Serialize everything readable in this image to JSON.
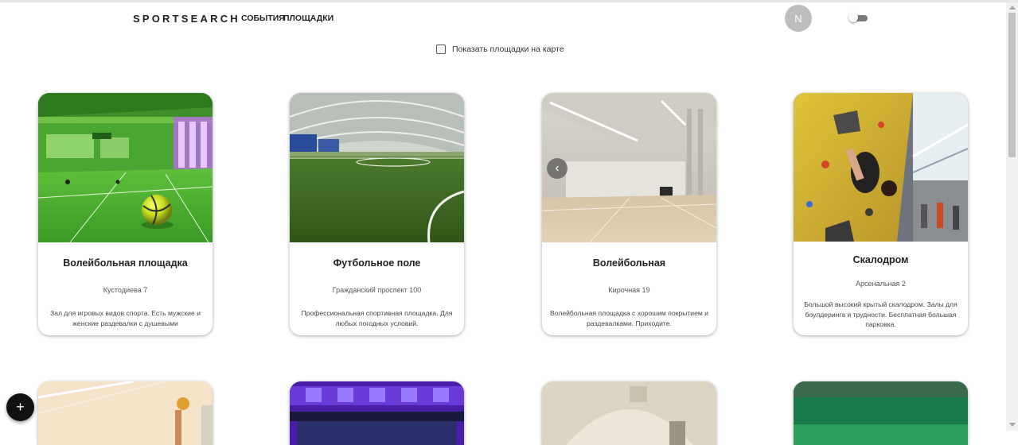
{
  "header": {
    "logo": "SPORTSEARCH",
    "nav": {
      "events": "СОБЫТИЯ",
      "places": "ПЛОЩАДКИ"
    },
    "avatar_initial": "N"
  },
  "map_toggle": {
    "label": "Показать площадки на карте",
    "checked": false
  },
  "cards": [
    {
      "title": "Волейбольная площадка",
      "address": "Кустодиева 7",
      "description": "Зал для игровых видов спорта. Есть мужские и женские раздевалки с душевыми"
    },
    {
      "title": "Футбольное поле",
      "address": "Гражданский проспект 100",
      "description": "Профессиональная спортивная площадка. Для любых погодных условий."
    },
    {
      "title": "Волейбольная",
      "address": "Кирочная 19",
      "description": "Волейбольная площадка с хорошим покрытием и раздевалками. Приходите."
    },
    {
      "title": "Скалодром",
      "address": "Арсенальная 2",
      "description": "Большой высокий крытый скалодром. Залы для боулдеринга и трудности. Бесплатная большая парковка."
    }
  ],
  "carousel_prev_icon": "‹",
  "fab_icon": "+",
  "icons": {
    "avatar": "user-avatar",
    "theme_toggle": "theme-toggle-switch",
    "fab": "plus-icon",
    "carousel": "chevron-left-icon"
  }
}
